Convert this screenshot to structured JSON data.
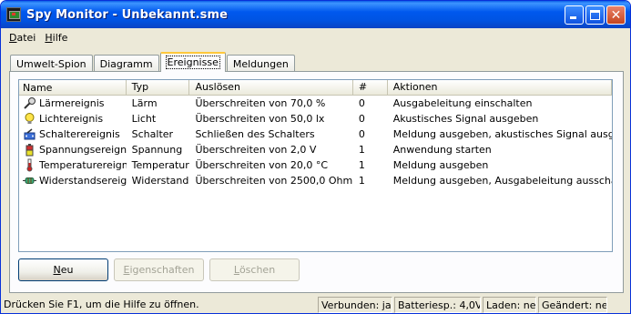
{
  "window": {
    "title": "Spy Monitor - Unbekannt.sme"
  },
  "menu": [
    {
      "underline": "D",
      "rest": "atei"
    },
    {
      "underline": "H",
      "rest": "ilfe"
    }
  ],
  "tabs": [
    {
      "label": "Umwelt-Spion",
      "active": false
    },
    {
      "label": "Diagramm",
      "active": false
    },
    {
      "label": "Ereignisse",
      "active": true
    },
    {
      "label": "Meldungen",
      "active": false
    }
  ],
  "list": {
    "columns": [
      "Name",
      "Typ",
      "Auslösen",
      "#",
      "Aktionen"
    ],
    "rows": [
      {
        "icon": "microphone-icon",
        "name": "Lärmereignis",
        "typ": "Lärm",
        "ausloesen": "Überschreiten von 70,0 %",
        "num": "0",
        "aktionen": "Ausgabeleitung einschalten"
      },
      {
        "icon": "lightbulb-icon",
        "name": "Lichtereignis",
        "typ": "Licht",
        "ausloesen": "Überschreiten von 50,0 lx",
        "num": "0",
        "aktionen": "Akustisches Signal ausgeben"
      },
      {
        "icon": "switch-icon",
        "name": "Schalterereignis",
        "typ": "Schalter",
        "ausloesen": "Schließen des Schalters",
        "num": "0",
        "aktionen": "Meldung ausgeben, akustisches Signal ausgeben"
      },
      {
        "icon": "battery-icon",
        "name": "Spannungsereignis",
        "typ": "Spannung",
        "ausloesen": "Überschreiten von 2,0 V",
        "num": "1",
        "aktionen": "Anwendung starten"
      },
      {
        "icon": "thermometer-icon",
        "name": "Temperaturereignis",
        "typ": "Temperatur",
        "ausloesen": "Überschreiten von 20,0 °C",
        "num": "1",
        "aktionen": "Meldung ausgeben"
      },
      {
        "icon": "resistor-icon",
        "name": "Widerstandsereignis",
        "typ": "Widerstand",
        "ausloesen": "Überschreiten von 2500,0 Ohm",
        "num": "1",
        "aktionen": "Meldung ausgeben, Ausgabeleitung ausschalten"
      }
    ]
  },
  "buttons": {
    "new": {
      "underline": "N",
      "rest": "eu"
    },
    "properties": {
      "underline": "E",
      "rest": "igenschaften"
    },
    "delete": {
      "underline": "L",
      "rest": "öschen"
    }
  },
  "status": {
    "hint": "Drücken Sie F1, um die Hilfe zu öffnen.",
    "connected": "Verbunden: ja",
    "battery": "Batteriesp.: 4,0V",
    "loading": "Laden: nein",
    "changed": "Geändert: nein"
  },
  "colors": {
    "title_bar": "#0054e3",
    "window_bg": "#ece9d8",
    "active_tab_highlight": "#ffc83c"
  }
}
